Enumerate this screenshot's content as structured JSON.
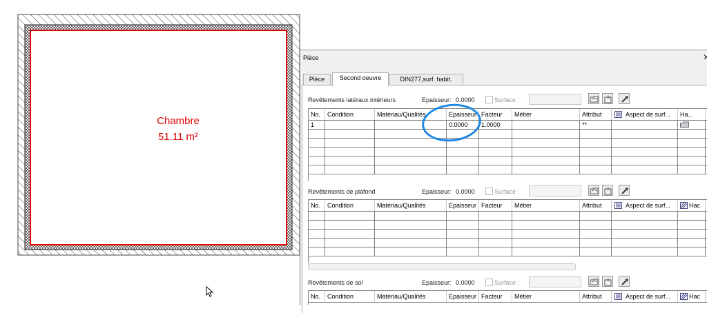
{
  "plan": {
    "room_name": "Chambre",
    "room_area": "51.11 m²",
    "room_text_color": "#e00000",
    "wall_outline_color": "#e00000"
  },
  "dialog": {
    "title": "Pièce",
    "close_icon": "close-icon",
    "tabs": [
      {
        "label": "Pièce",
        "active": false
      },
      {
        "label": "Second oeuvre",
        "active": true
      },
      {
        "label": "DIN277,surf. habit.",
        "active": false
      }
    ],
    "surface_label": "Surface :",
    "epaisseur_label": "Epaisseur:",
    "highlight_color": "#1e88e5",
    "sections": [
      {
        "label": "Revêtements latéraux intérieurs",
        "epaisseur": "0.0000",
        "columns": [
          "No.",
          "Condition",
          "Matériau/Qualités",
          "Epaisseur",
          "Facteur",
          "Métier",
          "Attribut",
          "Aspect de surf...",
          "Ha..."
        ],
        "rows": [
          {
            "no": "1",
            "condition": "",
            "materiau": "",
            "epaisseur": "0.0000",
            "facteur": "1.0000",
            "metier": "",
            "attribut": "**",
            "aspect": "",
            "hachure": ""
          }
        ]
      },
      {
        "label": "Revêtements de plafond",
        "epaisseur": "0.0000",
        "columns": [
          "No.",
          "Condition",
          "Matériau/Qualités",
          "Epaisseur",
          "Facteur",
          "Métier",
          "Attribut",
          "Aspect de surf...",
          "Hac"
        ],
        "rows": []
      },
      {
        "label": "Revêtements de sol",
        "epaisseur": "0.0000",
        "columns": [
          "No.",
          "Condition",
          "Matériau/Qualités",
          "Epaisseur",
          "Facteur",
          "Métier",
          "Attribut",
          "Aspect de surf...",
          "Hac"
        ],
        "rows": []
      }
    ]
  }
}
